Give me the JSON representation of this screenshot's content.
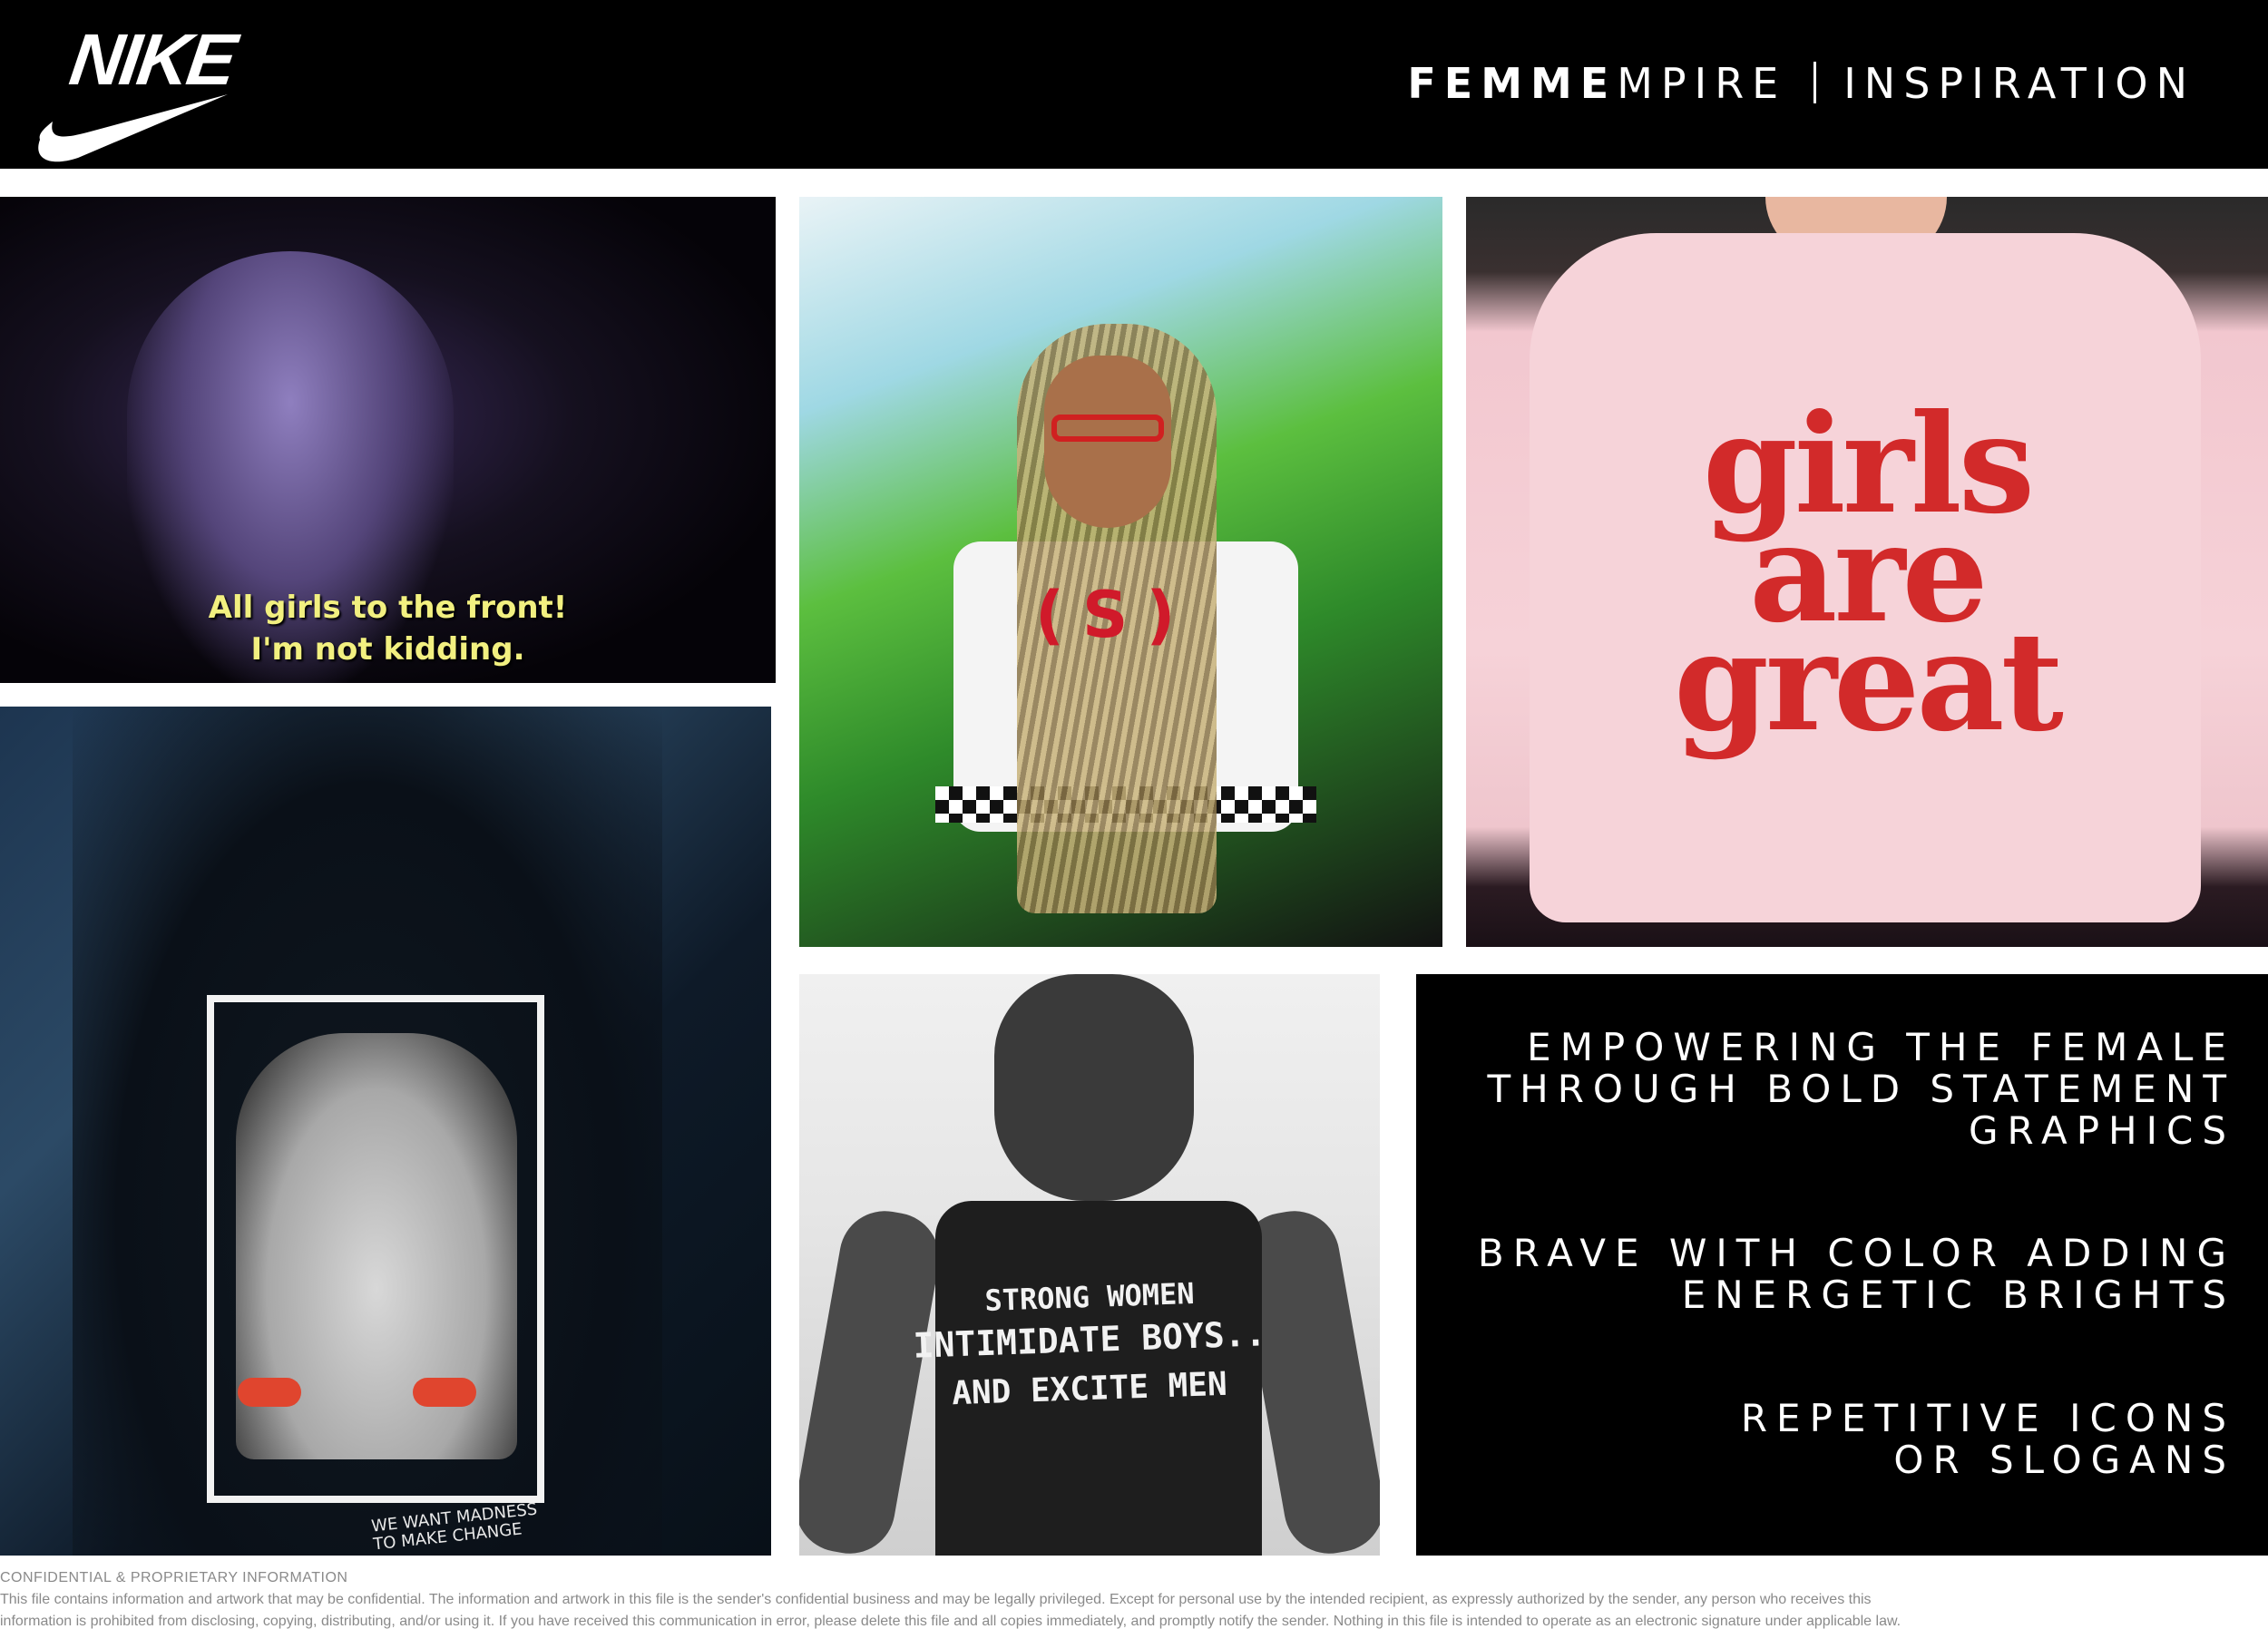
{
  "brand": {
    "logo_text": "NIKE"
  },
  "header": {
    "title_bold": "FEMME",
    "title_light": "MPIRE",
    "subtitle": "INSPIRATION"
  },
  "panels": {
    "concert": {
      "caption_line1": "All girls to the front!",
      "caption_line2": "I'm not kidding."
    },
    "braids": {
      "shirt_text": "(S)"
    },
    "pink_tee": {
      "line1": "girls",
      "line2": "are",
      "line3": "great"
    },
    "art_tee": {
      "sign_line1": "WE WANT MADNESS",
      "sign_line2": "TO MAKE CHANGE"
    },
    "strong_women": {
      "line1": "STRONG WOMEN",
      "line2": "INTIMIDATE BOYS..",
      "line3": "AND EXCITE MEN"
    }
  },
  "statements": {
    "s1_line1": "EMPOWERING THE FEMALE",
    "s1_line2": "THROUGH BOLD STATEMENT",
    "s1_line3": "GRAPHICS",
    "s2_line1": "BRAVE WITH COLOR ADDING",
    "s2_line2": "ENERGETIC BRIGHTS",
    "s3_line1": "REPETITIVE ICONS",
    "s3_line2": "OR SLOGANS"
  },
  "footer": {
    "title": "CONFIDENTIAL & PROPRIETARY INFORMATION",
    "line1": "This file contains information and artwork that may be confidential. The information and artwork in this file is the sender's confidential business and may be legally privileged. Except for personal use by the intended recipient, as expressly authorized by the sender, any person who receives this",
    "line2": "information is prohibited from disclosing, copying, distributing, and/or using it. If you have received this communication in error, please delete this file and all copies immediately, and promptly notify the sender. Nothing in this file is intended to operate as an electronic signature under applicable law."
  },
  "colors": {
    "background": "#ffffff",
    "header_bg": "#000000",
    "text_on_dark": "#ffffff",
    "caption_yellow": "#f2f080",
    "accent_red": "#d22a2a",
    "footer_gray": "#8a8a8a"
  }
}
